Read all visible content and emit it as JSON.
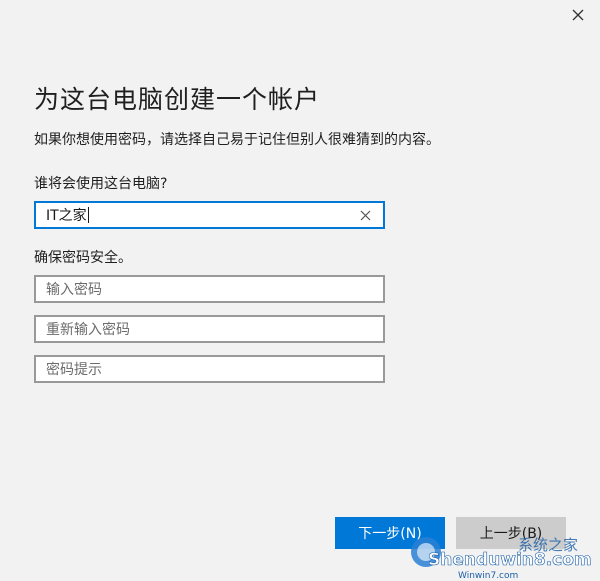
{
  "dialog": {
    "title": "为这台电脑创建一个帐户",
    "description": "如果你想使用密码，请选择自己易于记住但别人很难猜到的内容。",
    "close_icon": "close-icon"
  },
  "user_section": {
    "label": "谁将会使用这台电脑?",
    "username_value": "IT之家",
    "clear_icon": "clear-x-icon"
  },
  "password_section": {
    "label": "确保密码安全。",
    "password_placeholder": "输入密码",
    "reenter_placeholder": "重新输入密码",
    "hint_placeholder": "密码提示"
  },
  "buttons": {
    "next_label": "下一步(N)",
    "back_label": "上一步(B)"
  },
  "watermark": {
    "text_main": "Shenduwin8.com",
    "text_sub": "Winwin7.com",
    "text_cn": "系统之家"
  },
  "colors": {
    "accent": "#0078d7",
    "dialog_bg": "#f2f2f2",
    "input_border": "#999999",
    "back_button_bg": "#cccccc"
  }
}
